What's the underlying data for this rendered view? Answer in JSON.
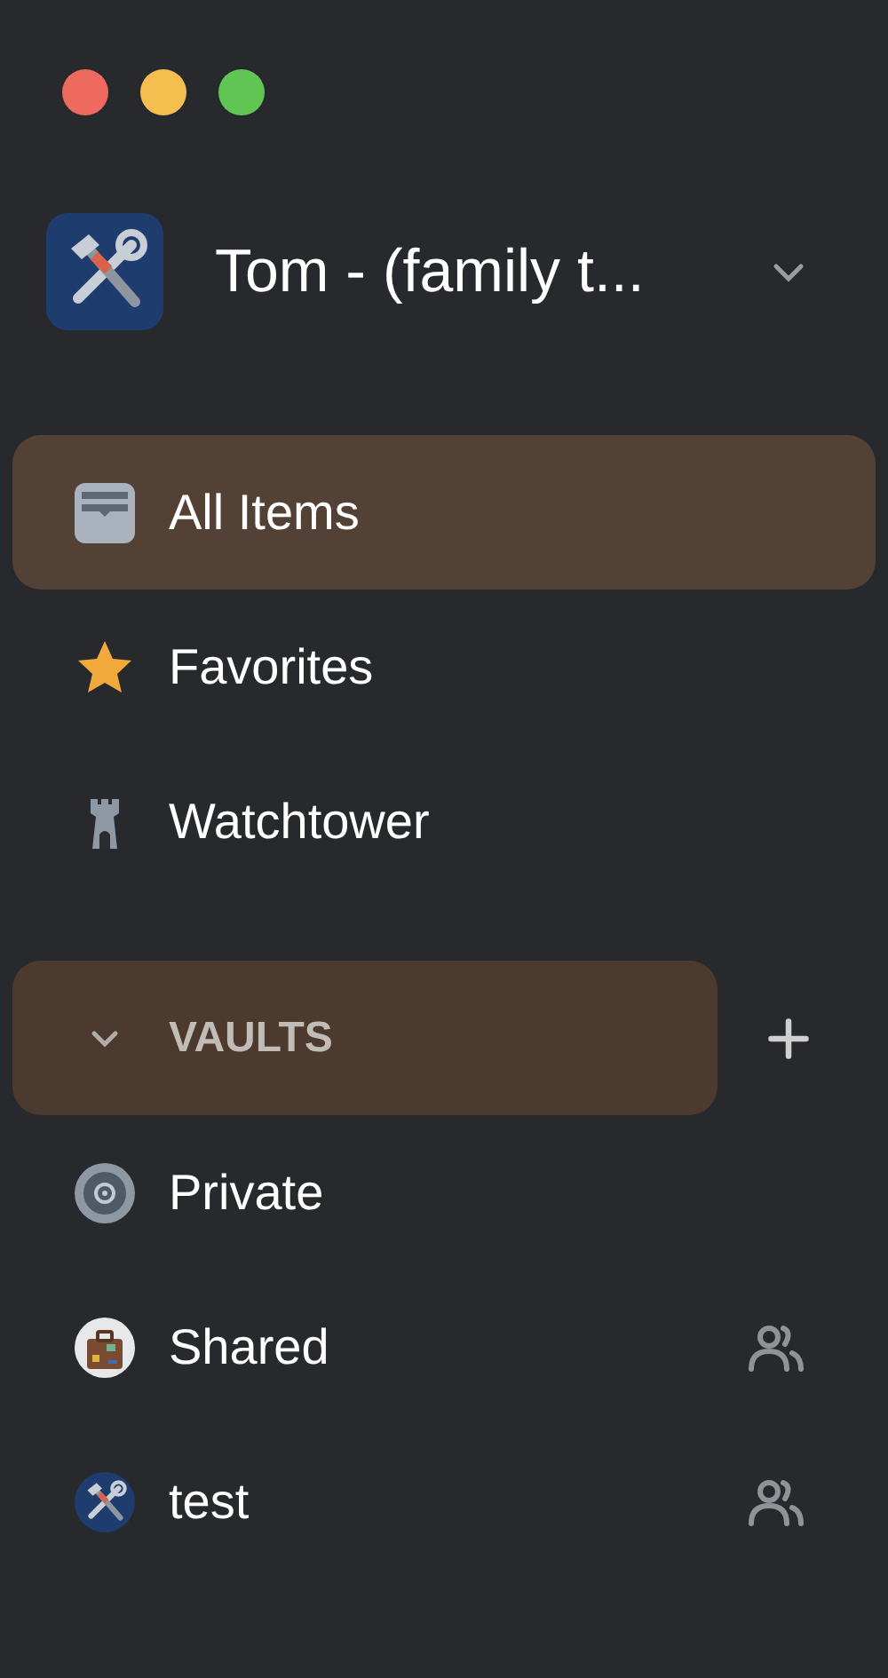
{
  "account": {
    "name": "Tom - (family t..."
  },
  "nav_items": [
    {
      "label": "All Items",
      "kind": "inbox",
      "selected": true
    },
    {
      "label": "Favorites",
      "kind": "star",
      "selected": false
    },
    {
      "label": "Watchtower",
      "kind": "tower",
      "selected": false
    }
  ],
  "vaults_section": {
    "label": "VAULTS",
    "expanded": true,
    "selected": true
  },
  "vaults": [
    {
      "label": "Private",
      "kind": "safe",
      "shared": false
    },
    {
      "label": "Shared",
      "kind": "suitcase",
      "shared": true
    },
    {
      "label": "test",
      "kind": "tools",
      "shared": true
    }
  ]
}
